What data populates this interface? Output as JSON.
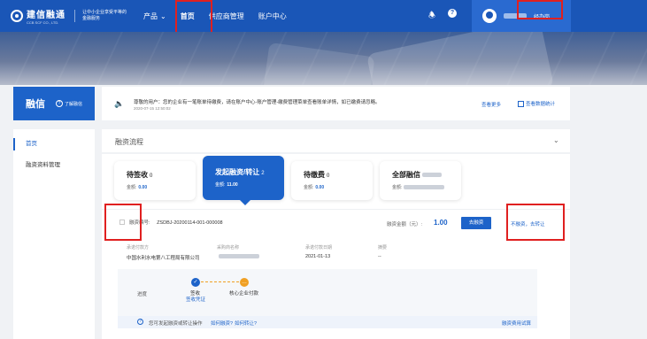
{
  "brand": {
    "name": "建信融通",
    "sub": "CCB SCF CO., LTD.",
    "slogan": "让中小企业享受平等的金融服务"
  },
  "nav": {
    "product": "产品",
    "home": "首页",
    "supplier": "供应商管理",
    "account": "账户中心"
  },
  "user": {
    "role": "经办岗"
  },
  "page": {
    "title": "融信",
    "help": "了解融信"
  },
  "notice": {
    "text": "尊敬的用户：您的企业有一笔账单待缴费，请在账户中心-账户管理-缴费管理菜单查看账单详情，如已缴费请忽略。",
    "date": "2020-07-15 12:50:02",
    "more": "查看更多",
    "all": "查看数据统计"
  },
  "sidebar": {
    "items": [
      {
        "label": "首页"
      },
      {
        "label": "融资资料管理"
      }
    ]
  },
  "flow": {
    "title": "融资流程"
  },
  "cards": [
    {
      "title": "待签收",
      "count": "0",
      "amount_label": "金额:",
      "amount": "0.00"
    },
    {
      "title": "发起融资/转让",
      "count": "2",
      "amount_label": "金额:",
      "amount": "11.00"
    },
    {
      "title": "待缴费",
      "count": "0",
      "amount_label": "金额:",
      "amount": "0.00"
    },
    {
      "title": "全部融信",
      "count": "",
      "amount_label": "金额:",
      "amount": ""
    }
  ],
  "application": {
    "no_label": "融资编号:",
    "no": "ZSDBJ-20200114-001-000008",
    "amount_label": "融资金额（元）:",
    "amount": "1.00",
    "finance_button": "去融资",
    "transfer_link": "不融资，去转让"
  },
  "details": [
    {
      "label": "承诺付款方",
      "value": "中国水利水电第八工程局有限公司"
    },
    {
      "label": "采购商名称",
      "value": ""
    },
    {
      "label": "承诺付款日期",
      "value": "2021-01-13"
    },
    {
      "label": "摘要",
      "value": "--"
    }
  ],
  "progress": {
    "label": "进度",
    "step1": "签收",
    "step1_link": "签收凭证",
    "step2": "核心企业付款"
  },
  "tip": {
    "text": "您可发起融资或转让操作",
    "link1": "如何融资?",
    "link2": "如何转让?",
    "right": "融资费用试算"
  },
  "colors": {
    "primary": "#1d63c9",
    "nav": "#1a56b7",
    "accent": "#f0a024",
    "highlight": "#e02020"
  }
}
